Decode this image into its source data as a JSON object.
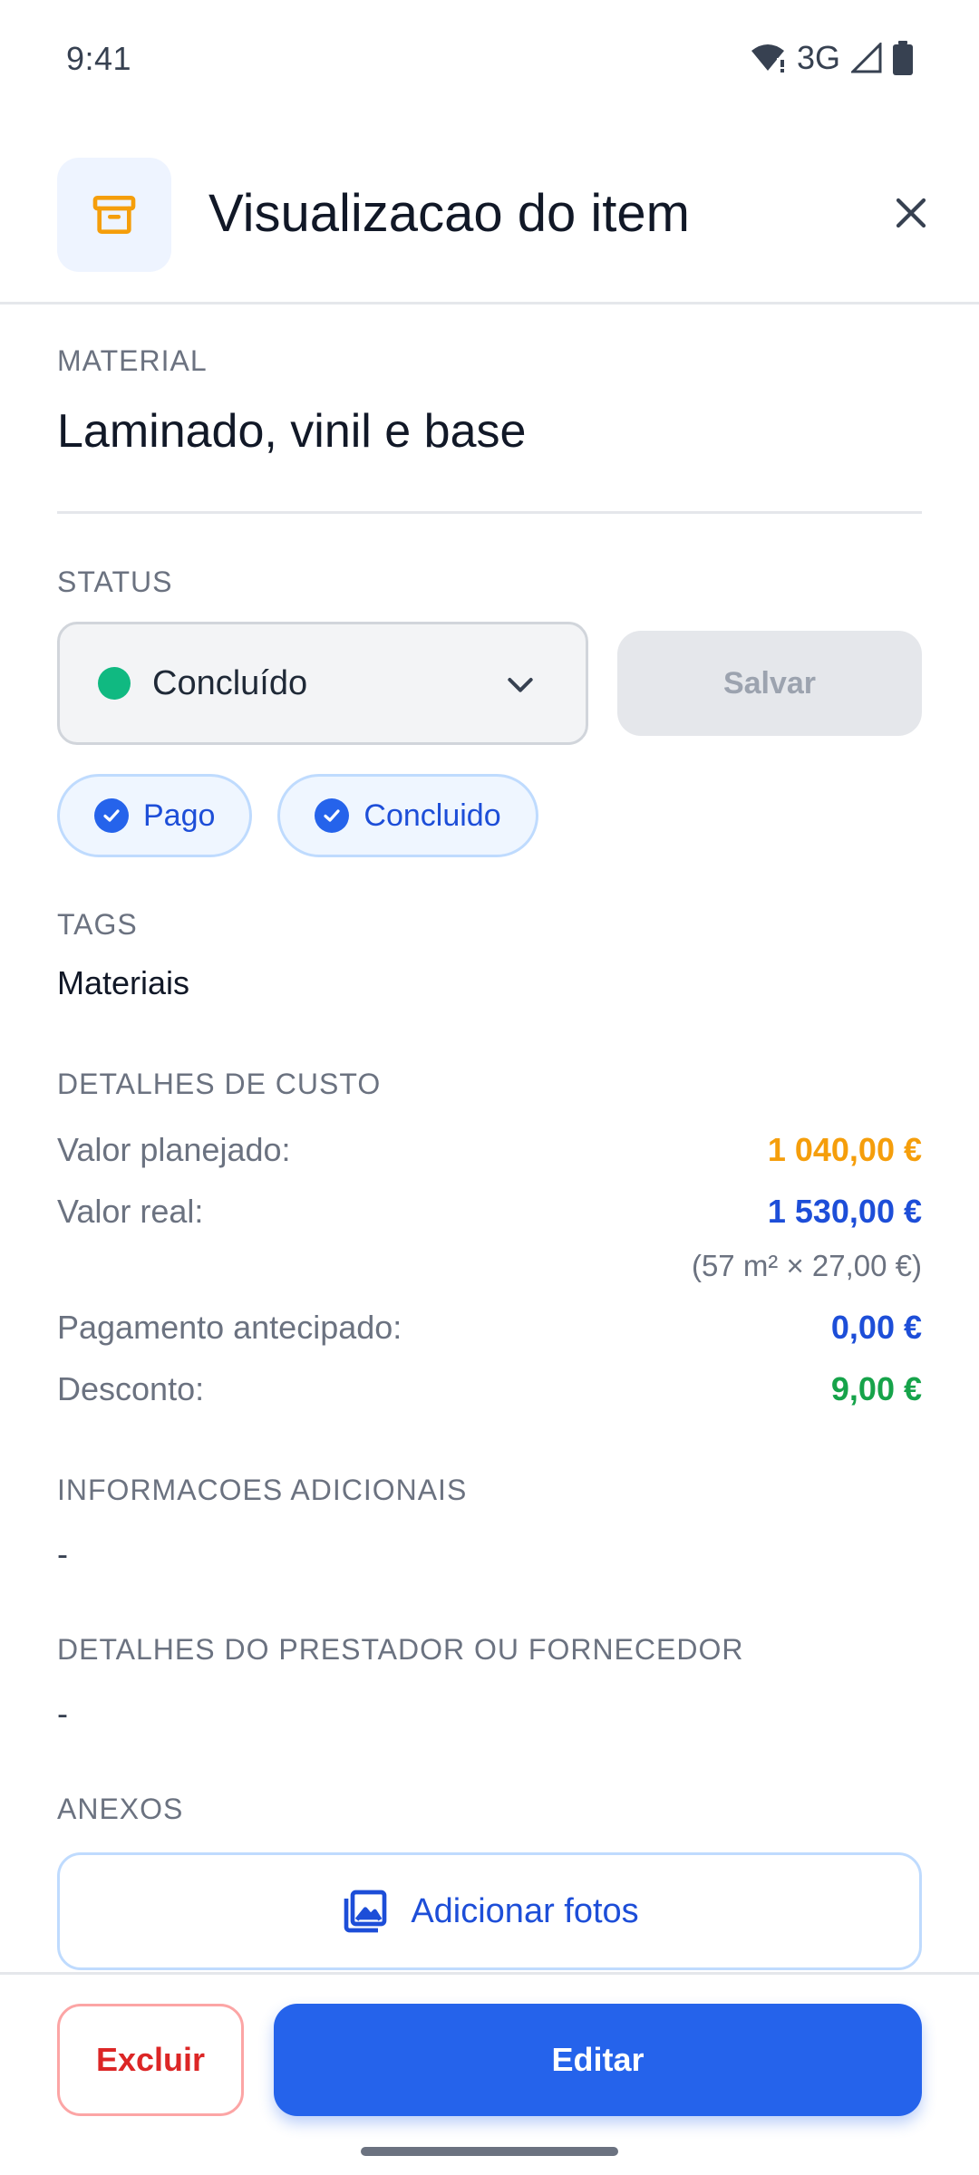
{
  "status_bar": {
    "time": "9:41",
    "network": "3G"
  },
  "header": {
    "icon": "archive-box-icon",
    "title": "Visualizacao do item"
  },
  "material": {
    "label": "MATERIAL",
    "value": "Laminado, vinil e base"
  },
  "status": {
    "label": "STATUS",
    "selected": "Concluído",
    "dot_color": "#10b981",
    "save_label": "Salvar"
  },
  "chips": [
    {
      "label": "Pago"
    },
    {
      "label": "Concluido"
    }
  ],
  "tags": {
    "label": "TAGS",
    "value": "Materiais"
  },
  "cost": {
    "label": "DETALHES DE CUSTO",
    "planned_label": "Valor planejado:",
    "planned_value": "1 040,00 €",
    "real_label": "Valor real:",
    "real_value": "1 530,00 €",
    "real_note": "(57 m² × 27,00 €)",
    "advance_label": "Pagamento antecipado:",
    "advance_value": "0,00 €",
    "discount_label": "Desconto:",
    "discount_value": "9,00 €"
  },
  "additional_info": {
    "label": "INFORMACOES ADICIONAIS",
    "value": "-"
  },
  "provider": {
    "label": "DETALHES DO PRESTADOR OU FORNECEDOR",
    "value": "-"
  },
  "attachments": {
    "label": "ANEXOS",
    "add_photos_label": "Adicionar fotos"
  },
  "footer": {
    "delete_label": "Excluir",
    "edit_label": "Editar"
  },
  "colors": {
    "primary": "#2563eb",
    "planned": "#f59e0b",
    "discount": "#16a34a",
    "danger": "#dc2626"
  }
}
